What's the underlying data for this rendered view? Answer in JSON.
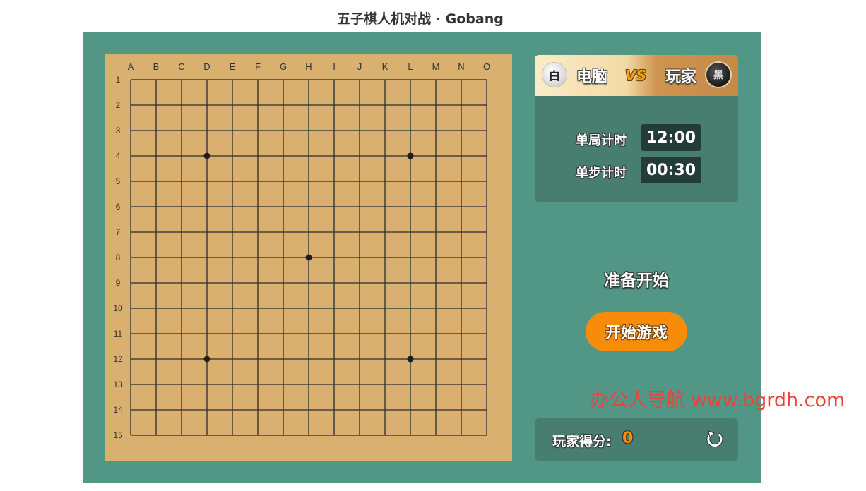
{
  "page": {
    "title": "五子棋人机对战 · Gobang"
  },
  "board": {
    "size": 15,
    "columns": [
      "A",
      "B",
      "C",
      "D",
      "E",
      "F",
      "G",
      "H",
      "I",
      "J",
      "K",
      "L",
      "M",
      "N",
      "O"
    ],
    "rows": [
      "1",
      "2",
      "3",
      "4",
      "5",
      "6",
      "7",
      "8",
      "9",
      "10",
      "11",
      "12",
      "13",
      "14",
      "15"
    ],
    "star_points": [
      [
        "D",
        "4"
      ],
      [
        "L",
        "4"
      ],
      [
        "H",
        "8"
      ],
      [
        "D",
        "12"
      ],
      [
        "L",
        "12"
      ]
    ],
    "colors": {
      "wood": "#dab071",
      "line": "#2b2b2b"
    }
  },
  "players": {
    "left": {
      "stone_label": "白",
      "name": "电脑"
    },
    "vs_label": "VS",
    "right": {
      "stone_label": "黑",
      "name": "玩家"
    }
  },
  "timers": {
    "game": {
      "label": "单局计时",
      "value": "12:00"
    },
    "step": {
      "label": "单步计时",
      "value": "00:30"
    }
  },
  "status": {
    "text": "准备开始"
  },
  "controls": {
    "start_label": "开始游戏"
  },
  "score": {
    "label": "玩家得分:",
    "value": "0"
  },
  "watermark": {
    "text": "办公人导航 www.bgrdh.com"
  },
  "colors": {
    "panel": "#529786",
    "panel_dark": "#477e70",
    "timer_box": "#233c37",
    "accent_orange": "#f78c0b",
    "watermark_red": "#e8443c"
  }
}
